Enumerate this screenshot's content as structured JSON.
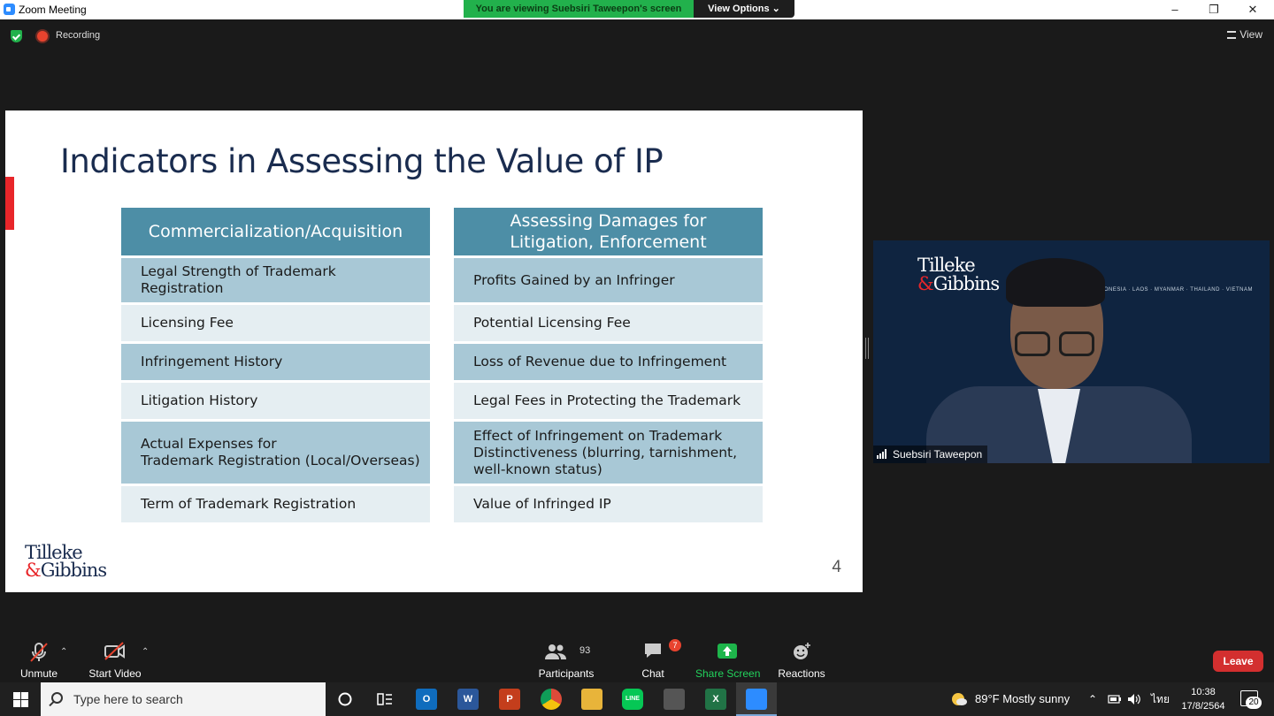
{
  "window": {
    "title": "Zoom Meeting",
    "minimize": "–",
    "maximize": "❐",
    "close": "✕"
  },
  "banner": {
    "viewing_text": "You are viewing Suebsiri Taweepon's screen",
    "view_options_label": "View Options ⌄"
  },
  "meeting": {
    "recording_label": "Recording",
    "view_label": "View"
  },
  "slide": {
    "title": "Indicators in Assessing the Value of IP",
    "page_number": "4",
    "logo_line1": "Tilleke",
    "logo_amp": "&",
    "logo_line2": "Gibbins",
    "left_column": {
      "header": "Commercialization/Acquisition",
      "rows": [
        "Legal Strength of Trademark Registration",
        "Licensing Fee",
        "Infringement History",
        "Litigation History",
        "Actual Expenses for\nTrademark Registration (Local/Overseas)",
        "Term of Trademark Registration"
      ]
    },
    "right_column": {
      "header": "Assessing Damages for\nLitigation, Enforcement",
      "rows": [
        "Profits Gained by an Infringer",
        "Potential Licensing Fee",
        "Loss of Revenue due to Infringement",
        "Legal Fees in Protecting the Trademark",
        "Effect of Infringement on Trademark\nDistinctiveness (blurring, tarnishment,\nwell-known status)",
        "Value of Infringed IP"
      ]
    }
  },
  "video": {
    "participant_name": "Suebsiri Taweepon",
    "bg_logo_line1": "Tilleke",
    "bg_logo_amp": "&",
    "bg_logo_line2": "Gibbins",
    "bg_countries": "A · INDONESIA · LAOS · MYANMAR · THAILAND · VIETNAM"
  },
  "toolbar": {
    "unmute": "Unmute",
    "start_video": "Start Video",
    "participants": "Participants",
    "participants_count": "93",
    "chat": "Chat",
    "chat_badge": "7",
    "share_screen": "Share Screen",
    "reactions": "Reactions",
    "leave": "Leave"
  },
  "taskbar": {
    "search_placeholder": "Type here to search",
    "weather": "89°F  Mostly sunny",
    "language": "ไทย",
    "time": "10:38",
    "date": "17/8/2564",
    "notification_count": "20",
    "apps": [
      {
        "name": "outlook",
        "label": "O",
        "color": "#0f6cbd"
      },
      {
        "name": "word",
        "label": "W",
        "color": "#2b579a"
      },
      {
        "name": "powerpoint",
        "label": "P",
        "color": "#c43e1c"
      },
      {
        "name": "chrome",
        "label": "",
        "color": "#dd4b39"
      },
      {
        "name": "file-explorer",
        "label": "",
        "color": "#e8b43a"
      },
      {
        "name": "line",
        "label": "LINE",
        "color": "#06c755"
      },
      {
        "name": "store",
        "label": "",
        "color": "#555555"
      },
      {
        "name": "excel",
        "label": "X",
        "color": "#217346"
      },
      {
        "name": "zoom",
        "label": "",
        "color": "#2d8cff"
      }
    ]
  },
  "colors": {
    "slide_header": "#4d8ea6",
    "slide_row_dark": "#a8c8d6",
    "slide_row_light": "#e5eef2",
    "title_navy": "#1a2c4f",
    "accent_red": "#e8262a",
    "zoom_green": "#22b14c"
  }
}
